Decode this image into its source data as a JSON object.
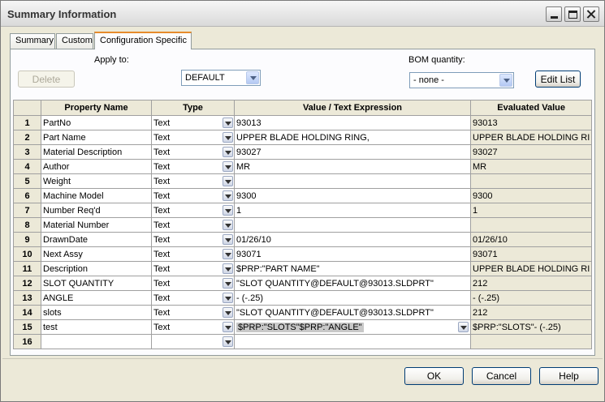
{
  "window": {
    "title": "Summary Information"
  },
  "tabs": [
    "Summary",
    "Custom",
    "Configuration Specific"
  ],
  "config": {
    "apply_to_label": "Apply to:",
    "apply_to_value": "DEFAULT",
    "bom_label": "BOM quantity:",
    "bom_value": "- none -",
    "delete_label": "Delete",
    "edit_list_label": "Edit List"
  },
  "table": {
    "headers": [
      "",
      "Property Name",
      "Type",
      "Value / Text Expression",
      "Evaluated Value"
    ],
    "rows": [
      {
        "n": "1",
        "name": "PartNo",
        "type": "Text",
        "value": "93013",
        "eval": "93013"
      },
      {
        "n": "2",
        "name": "Part Name",
        "type": "Text",
        "value": "UPPER BLADE HOLDING RING,",
        "eval": "UPPER BLADE HOLDING RI"
      },
      {
        "n": "3",
        "name": "Material Description",
        "type": "Text",
        "value": "93027",
        "eval": "93027"
      },
      {
        "n": "4",
        "name": "Author",
        "type": "Text",
        "value": "MR",
        "eval": "MR"
      },
      {
        "n": "5",
        "name": "Weight",
        "type": "Text",
        "value": "",
        "eval": ""
      },
      {
        "n": "6",
        "name": "Machine Model",
        "type": "Text",
        "value": "9300",
        "eval": "9300"
      },
      {
        "n": "7",
        "name": "Number Req'd",
        "type": "Text",
        "value": "1",
        "eval": "1"
      },
      {
        "n": "8",
        "name": "Material Number",
        "type": "Text",
        "value": "",
        "eval": ""
      },
      {
        "n": "9",
        "name": "DrawnDate",
        "type": "Text",
        "value": "01/26/10",
        "eval": "01/26/10"
      },
      {
        "n": "10",
        "name": "Next Assy",
        "type": "Text",
        "value": "93071",
        "eval": "93071"
      },
      {
        "n": "11",
        "name": "Description",
        "type": "Text",
        "value": "$PRP:\"PART NAME\"",
        "eval": "UPPER BLADE HOLDING RI"
      },
      {
        "n": "12",
        "name": "SLOT QUANTITY",
        "type": "Text",
        "value": "\"SLOT QUANTITY@DEFAULT@93013.SLDPRT\"",
        "eval": "212"
      },
      {
        "n": "13",
        "name": "ANGLE",
        "type": "Text",
        "value": "- (-.25)",
        "eval": "- (-.25)"
      },
      {
        "n": "14",
        "name": "slots",
        "type": "Text",
        "value": "\"SLOT QUANTITY@DEFAULT@93013.SLDPRT\"",
        "eval": "212"
      },
      {
        "n": "15",
        "name": "test",
        "type": "Text",
        "value": "$PRP:\"SLOTS\"$PRP:\"ANGLE\"",
        "eval": "$PRP:\"SLOTS\"- (-.25)"
      },
      {
        "n": "16",
        "name": "",
        "type": "",
        "value": "",
        "eval": ""
      }
    ]
  },
  "buttons": {
    "ok": "OK",
    "cancel": "Cancel",
    "help": "Help"
  }
}
